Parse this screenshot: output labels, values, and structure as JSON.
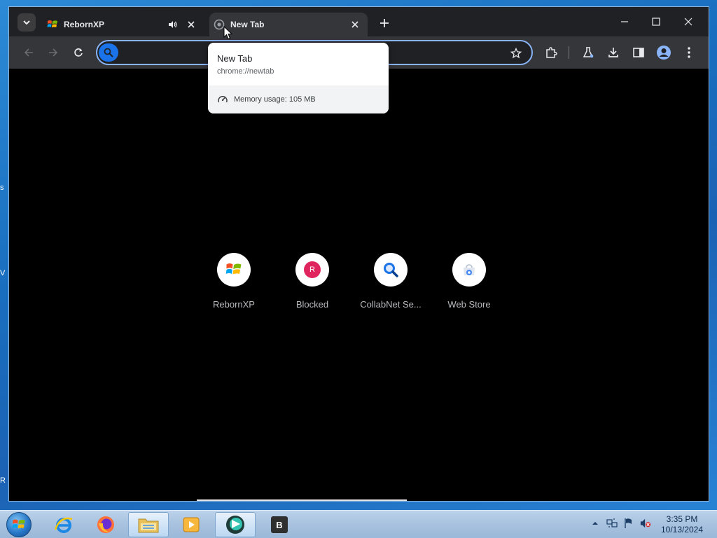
{
  "browser": {
    "tabs": [
      {
        "title": "RebornXP",
        "state": "inactive",
        "audio": true
      },
      {
        "title": "New Tab",
        "state": "active"
      }
    ],
    "omnibox": {
      "value": "",
      "placeholder": ""
    },
    "hovercard": {
      "title": "New Tab",
      "url": "chrome://newtab",
      "memory": "Memory usage: 105 MB"
    },
    "shortcuts": [
      {
        "label": "RebornXP",
        "icon": "windows-flag-icon"
      },
      {
        "label": "Blocked",
        "icon": "letter-r-icon",
        "letter": "R"
      },
      {
        "label": "CollabNet Se...",
        "icon": "magnifier-icon"
      },
      {
        "label": "Web Store",
        "icon": "web-store-icon"
      }
    ]
  },
  "taskbar": {
    "items": [
      {
        "name": "internet-explorer",
        "icon": "internet-explorer-icon"
      },
      {
        "name": "firefox",
        "icon": "firefox-icon"
      },
      {
        "name": "file-explorer",
        "icon": "folder-icon"
      },
      {
        "name": "media-player",
        "icon": "media-player-icon"
      },
      {
        "name": "browser-active",
        "icon": "browser-icon"
      },
      {
        "name": "app-b",
        "icon": "letter-b-icon",
        "letter": "B"
      }
    ],
    "clock": {
      "time": "3:35 PM",
      "date": "10/13/2024"
    }
  },
  "colors": {
    "accent": "#8ab4f8",
    "blocked_red": "#e0245e",
    "search_blue": "#1a73e8"
  }
}
